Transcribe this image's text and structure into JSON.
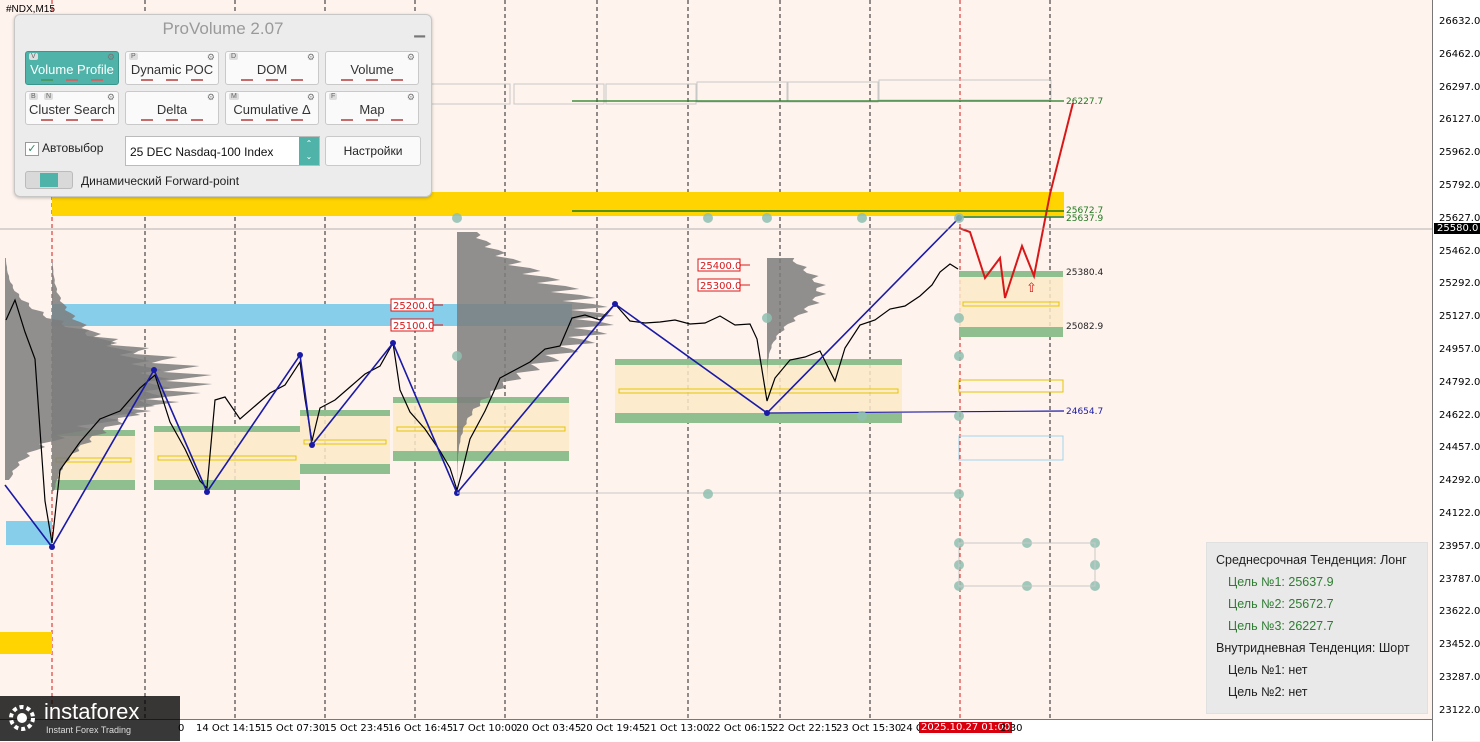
{
  "symbol": "#NDX,M15",
  "panel": {
    "title": "ProVolume 2.07",
    "buttons": [
      {
        "key": "V",
        "label": "Volume Profile",
        "active": true
      },
      {
        "key": "P",
        "label": "Dynamic POC",
        "active": false
      },
      {
        "key": "D",
        "label": "DOM",
        "active": false
      },
      {
        "key": "",
        "label": "Volume",
        "active": false
      },
      {
        "key": "B",
        "key2": "N",
        "label": "Cluster Search",
        "active": false
      },
      {
        "key": "",
        "label": "Delta",
        "active": false
      },
      {
        "key": "M",
        "label": "Cumulative Δ",
        "active": false
      },
      {
        "key": "F",
        "label": "Map",
        "active": false
      }
    ],
    "autoselect_label": "Автовыбор",
    "autoselect_checked": true,
    "instrument": "25 DEC Nasdaq-100 Index",
    "settings_label": "Настройки",
    "forward_point_label": "Динамический Forward-point"
  },
  "price_axis": {
    "ticks": [
      "26632.0",
      "26462.0",
      "26297.0",
      "26127.0",
      "25962.0",
      "25792.0",
      "25627.0",
      "25462.0",
      "25292.0",
      "25127.0",
      "24957.0",
      "24792.0",
      "24622.0",
      "24457.0",
      "24292.0",
      "24122.0",
      "23957.0",
      "23787.0",
      "23622.0",
      "23452.0",
      "23287.0",
      "23122.0"
    ],
    "current": "25580.0"
  },
  "time_axis": {
    "ticks": [
      "14 Oct 14:15",
      "15 Oct 07:30",
      "15 Oct 23:45",
      "16 Oct 16:45",
      "17 Oct 10:00",
      "20 Oct 03:45",
      "20 Oct 19:45",
      "21 Oct 13:00",
      "22 Oct 06:15",
      "22 Oct 22:15",
      "23 Oct 15:30",
      "24 C"
    ],
    "current": "2025.10.27 01:00",
    "after": "2:30",
    "partial_left": "0"
  },
  "levels": {
    "l1": "26227.7",
    "l2": "25672.7",
    "l3": "25637.9",
    "l4": "25380.4",
    "l5": "25082.9",
    "l6": "24654.7"
  },
  "boxes": {
    "b1": "25400.0",
    "b2": "25300.0",
    "b3": "25200.0",
    "b4": "25100.0"
  },
  "trend": {
    "mid_title": "Среднесрочная Тенденция: Лонг",
    "mid_t1": "Цель №1: 25637.9",
    "mid_t2": "Цель №2: 25672.7",
    "mid_t3": "Цель №3: 26227.7",
    "intra_title": "Внутридневная Тенденция: Шорт",
    "intra_t1": "Цель №1: нет",
    "intra_t2": "Цель №2: нет"
  },
  "logo": {
    "name": "instaforex",
    "tagline": "Instant Forex Trading"
  },
  "colors": {
    "background": "#fff3ee",
    "zigzag": "#1a1aa8",
    "forecast": "#d81818",
    "gold_zone": "#ffd400",
    "blue_zone": "#87ceeb",
    "green_band": "#8fbf8f",
    "level_green": "#1e7a1e"
  }
}
